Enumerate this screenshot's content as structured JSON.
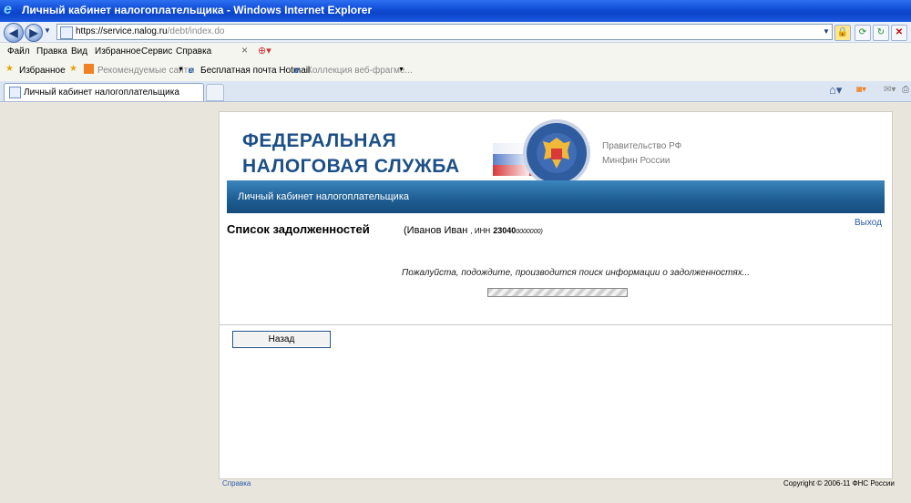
{
  "window": {
    "title": "Личный кабинет налогоплательщика - Windows Internet Explorer"
  },
  "address": {
    "url_main": "https://service.nalog.ru",
    "url_path": "/debt/index.do"
  },
  "menu": [
    "Файл",
    "Правка",
    "Вид",
    "Избранное",
    "Сервис",
    "Справка"
  ],
  "favorites": {
    "label": "Избранное",
    "items": [
      "Рекомендуемые сайты",
      "Бесплатная почта Hotmail",
      "Коллекция веб-фрагме..."
    ]
  },
  "tab": {
    "label": "Личный кабинет налогоплательщика"
  },
  "page": {
    "logo_line1": "ФЕДЕРАЛЬНАЯ",
    "logo_line2": "НАЛОГОВАЯ СЛУЖБА",
    "gov_line1": "Правительство РФ",
    "gov_line2": "Минфин России",
    "banner": "Личный кабинет налогоплательщика",
    "list_title": "Список задолженностей",
    "user_name": "(Иванов Иван",
    "inn_label": ", ИНН",
    "inn_bold": "23040",
    "inn_rest": "0000000)",
    "logout": "Выход",
    "wait_text": "Пожалуйста, подождите, производится поиск информации о задолженностях...",
    "back_button": "Назад",
    "footer_help": "Справка",
    "footer_copyright": "Copyright © 2006-11 ФНС России"
  },
  "colors": {
    "brand_blue": "#1d4f86",
    "banner_blue": "#1f5f95",
    "link_blue": "#2a5aa8"
  }
}
